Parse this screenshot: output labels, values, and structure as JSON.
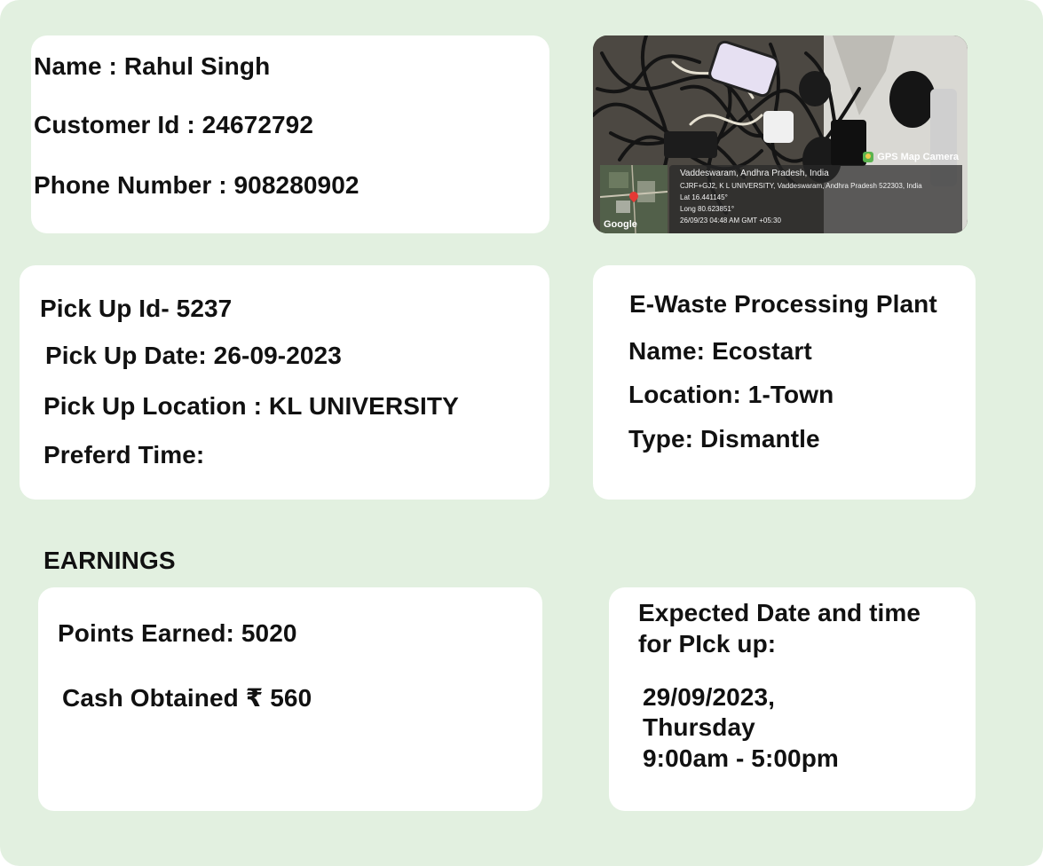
{
  "customer": {
    "name_line": "Name : Rahul Singh",
    "id_line": "Customer Id : 24672792",
    "phone_line": "Phone Number : 908280902"
  },
  "photo": {
    "badge": "GPS Map Camera",
    "place": "Vaddeswaram, Andhra Pradesh, India",
    "address": "CJRF+GJ2, K L UNIVERSITY, Vaddeswaram, Andhra Pradesh 522303, India",
    "lat": "Lat 16.441145°",
    "long": "Long 80.623851°",
    "timestamp": "26/09/23 04:48 AM GMT +05:30",
    "map_label": "Google"
  },
  "pickup": {
    "id_line": "Pick Up Id- 5237",
    "date_line": "Pick Up Date: 26-09-2023",
    "location_line": "Pick Up Location : KL UNIVERSITY",
    "time_line": "Preferd Time:"
  },
  "plant": {
    "title": "E-Waste Processing Plant",
    "name_line": "Name: Ecostart",
    "location_line": "Location: 1-Town",
    "type_line": "Type: Dismantle"
  },
  "earnings": {
    "heading": "EARNINGS",
    "points_line": "Points Earned: 5020",
    "cash_line": "Cash Obtained ₹ 560"
  },
  "expected": {
    "title_line1": "Expected Date and time",
    "title_line2": "for PIck up:",
    "date": "29/09/2023,",
    "day": "Thursday",
    "time": "9:00am - 5:00pm"
  }
}
